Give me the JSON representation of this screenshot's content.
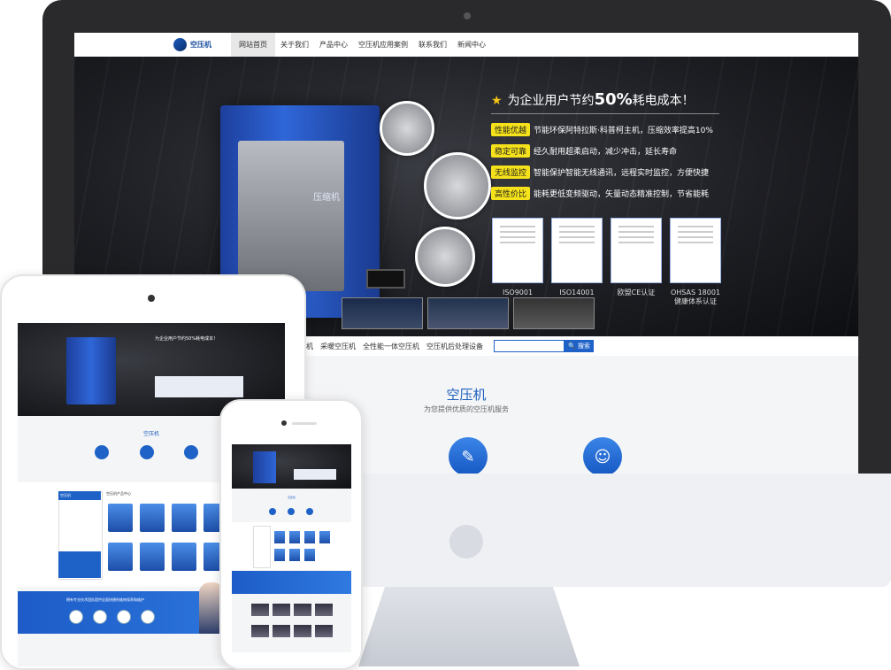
{
  "desktop": {
    "brand": "空压机",
    "nav": [
      "网站首页",
      "关于我们",
      "产品中心",
      "空压机应用案例",
      "联系我们",
      "新闻中心"
    ],
    "hero": {
      "headline_pre": "为企业用户节约",
      "headline_pct": "50%",
      "headline_post": "耗电成本！",
      "features": [
        {
          "tag": "性能优越",
          "text": "节能环保阿特拉斯·科普柯主机，压缩效率提高10%"
        },
        {
          "tag": "稳定可靠",
          "text": "经久耐用超柔启动，减少冲击，延长寿命"
        },
        {
          "tag": "无线监控",
          "text": "智能保护智能无线通讯，远程实时监控，方便快捷"
        },
        {
          "tag": "高性价比",
          "text": "能耗更低变频驱动，矢量动态精准控制，节省能耗"
        }
      ],
      "machine_label": "压缩机",
      "certs": [
        "ISO9001",
        "ISO14001",
        "欧盟CE认证",
        "OHSAS 18001 健康体系认证"
      ]
    },
    "subnav": [
      "空压机",
      "采暖空压机",
      "全性能一体空压机",
      "空压机后处理设备"
    ],
    "search": {
      "placeholder": "",
      "button": "搜索"
    },
    "section": {
      "title": "空压机",
      "subtitle": "为您提供优质的空压机服务"
    }
  },
  "tablet": {
    "headline": "为企业用户节约50%耗电成本！",
    "section_title": "空压机",
    "side_heading": "空压机",
    "product_heading": "空压机产品中心",
    "banner_text": "拥有专业技术团队提供全面快捷的维修保养和维护"
  },
  "phone": {
    "section_title": "空压机"
  }
}
